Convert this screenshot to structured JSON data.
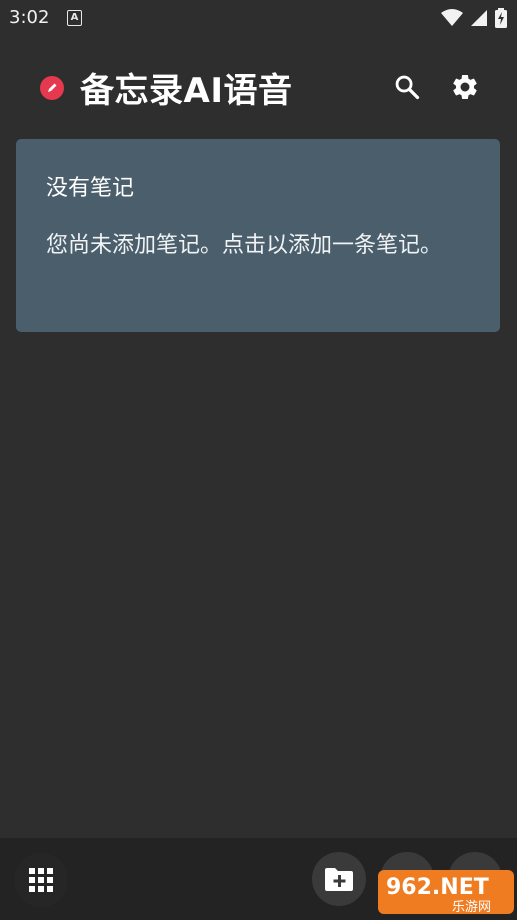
{
  "status_bar": {
    "time": "3:02",
    "notification_icon_letter": "A"
  },
  "app_bar": {
    "title": "备忘录AI语音"
  },
  "empty_card": {
    "title": "没有笔记",
    "message": "您尚未添加笔记。点击以添加一条笔记。"
  },
  "watermark": {
    "line1": "962.NET",
    "line2": "乐游网"
  },
  "colors": {
    "background": "#2e2e2e",
    "card": "#4b5e6b",
    "accent": "#e53950",
    "bottom_bar": "#232323"
  },
  "icons": [
    "pencil-icon",
    "search-icon",
    "gear-icon",
    "grid-icon",
    "folder-add-icon",
    "wifi-icon",
    "signal-icon",
    "battery-icon"
  ]
}
